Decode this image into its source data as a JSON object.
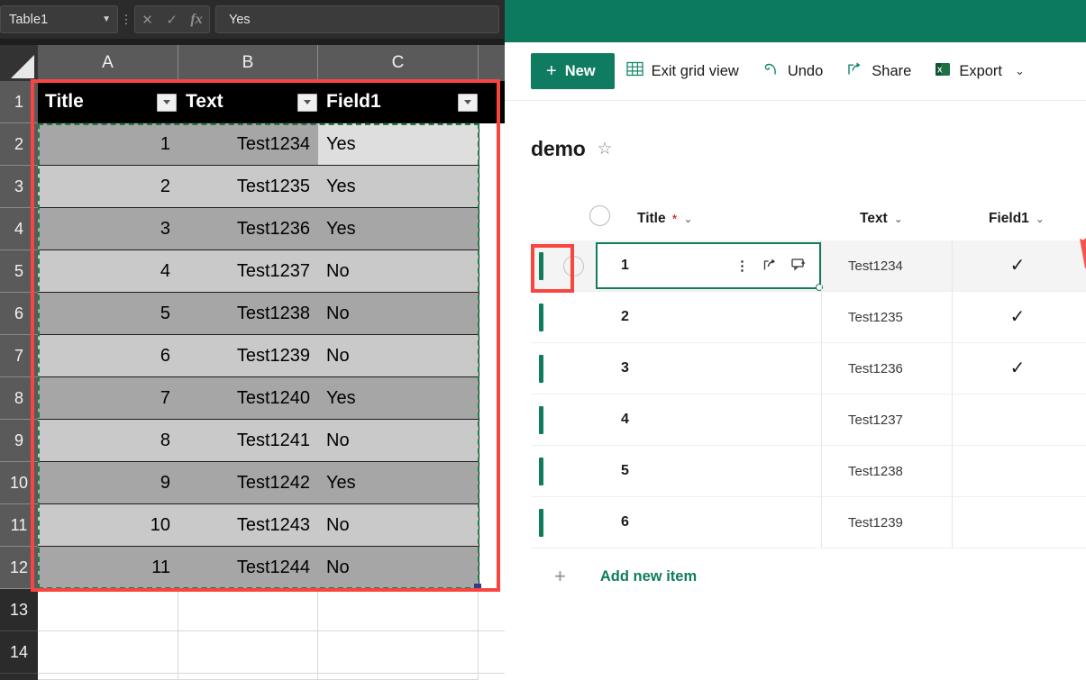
{
  "excel": {
    "name_box": {
      "value": "Table1",
      "chevron": "chevron-down-icon"
    },
    "more_dots": "⋮",
    "formula_actions": {
      "cancel": "✕",
      "enter": "✓",
      "function": "fx"
    },
    "formula_bar": {
      "value": "Yes"
    },
    "columns": [
      "A",
      "B",
      "C"
    ],
    "row_numbers": [
      "1",
      "2",
      "3",
      "4",
      "5",
      "6",
      "7",
      "8",
      "9",
      "10",
      "11",
      "12",
      "13",
      "14"
    ],
    "table": {
      "headers": [
        "Title",
        "Text",
        "Field1"
      ],
      "rows": [
        {
          "title": "1",
          "text": "Test1234",
          "field1": "Yes"
        },
        {
          "title": "2",
          "text": "Test1235",
          "field1": "Yes"
        },
        {
          "title": "3",
          "text": "Test1236",
          "field1": "Yes"
        },
        {
          "title": "4",
          "text": "Test1237",
          "field1": "No"
        },
        {
          "title": "5",
          "text": "Test1238",
          "field1": "No"
        },
        {
          "title": "6",
          "text": "Test1239",
          "field1": "No"
        },
        {
          "title": "7",
          "text": "Test1240",
          "field1": "Yes"
        },
        {
          "title": "8",
          "text": "Test1241",
          "field1": "No"
        },
        {
          "title": "9",
          "text": "Test1242",
          "field1": "Yes"
        },
        {
          "title": "10",
          "text": "Test1243",
          "field1": "No"
        },
        {
          "title": "11",
          "text": "Test1244",
          "field1": "No"
        }
      ]
    }
  },
  "sharepoint": {
    "toolbar": {
      "new_label": "New",
      "new_plus": "+",
      "exit_grid_label": "Exit grid view",
      "undo_label": "Undo",
      "share_label": "Share",
      "export_label": "Export",
      "export_chevron": "⌄"
    },
    "list": {
      "title": "demo",
      "favorite_icon": "☆",
      "columns": [
        {
          "label": "Title",
          "required": "*",
          "chevron": "⌄"
        },
        {
          "label": "Text",
          "required": "",
          "chevron": "⌄"
        },
        {
          "label": "Field1",
          "required": "",
          "chevron": "⌄"
        }
      ],
      "add_column": "+",
      "rows": [
        {
          "title": "1",
          "text": "Test1234",
          "field1_check": "✓"
        },
        {
          "title": "2",
          "text": "Test1235",
          "field1_check": "✓"
        },
        {
          "title": "3",
          "text": "Test1236",
          "field1_check": "✓"
        },
        {
          "title": "4",
          "text": "Test1237",
          "field1_check": ""
        },
        {
          "title": "5",
          "text": "Test1238",
          "field1_check": ""
        },
        {
          "title": "6",
          "text": "Test1239",
          "field1_check": ""
        }
      ],
      "editing_cell": {
        "value": "1",
        "more_icon": "⋮",
        "open_icon": "↗",
        "comment_icon": "▭"
      },
      "add_new_item": {
        "plus": "+",
        "label": "Add new item"
      }
    }
  },
  "colors": {
    "sharepoint_green": "#0b7a5d",
    "button_green": "#0f7b60",
    "link_green": "#107c5e",
    "annotation_red": "#f9453f",
    "excel_header_black": "#000000",
    "excel_band_dark": "#a6a6a6",
    "excel_band_light": "#c9c9c9"
  }
}
